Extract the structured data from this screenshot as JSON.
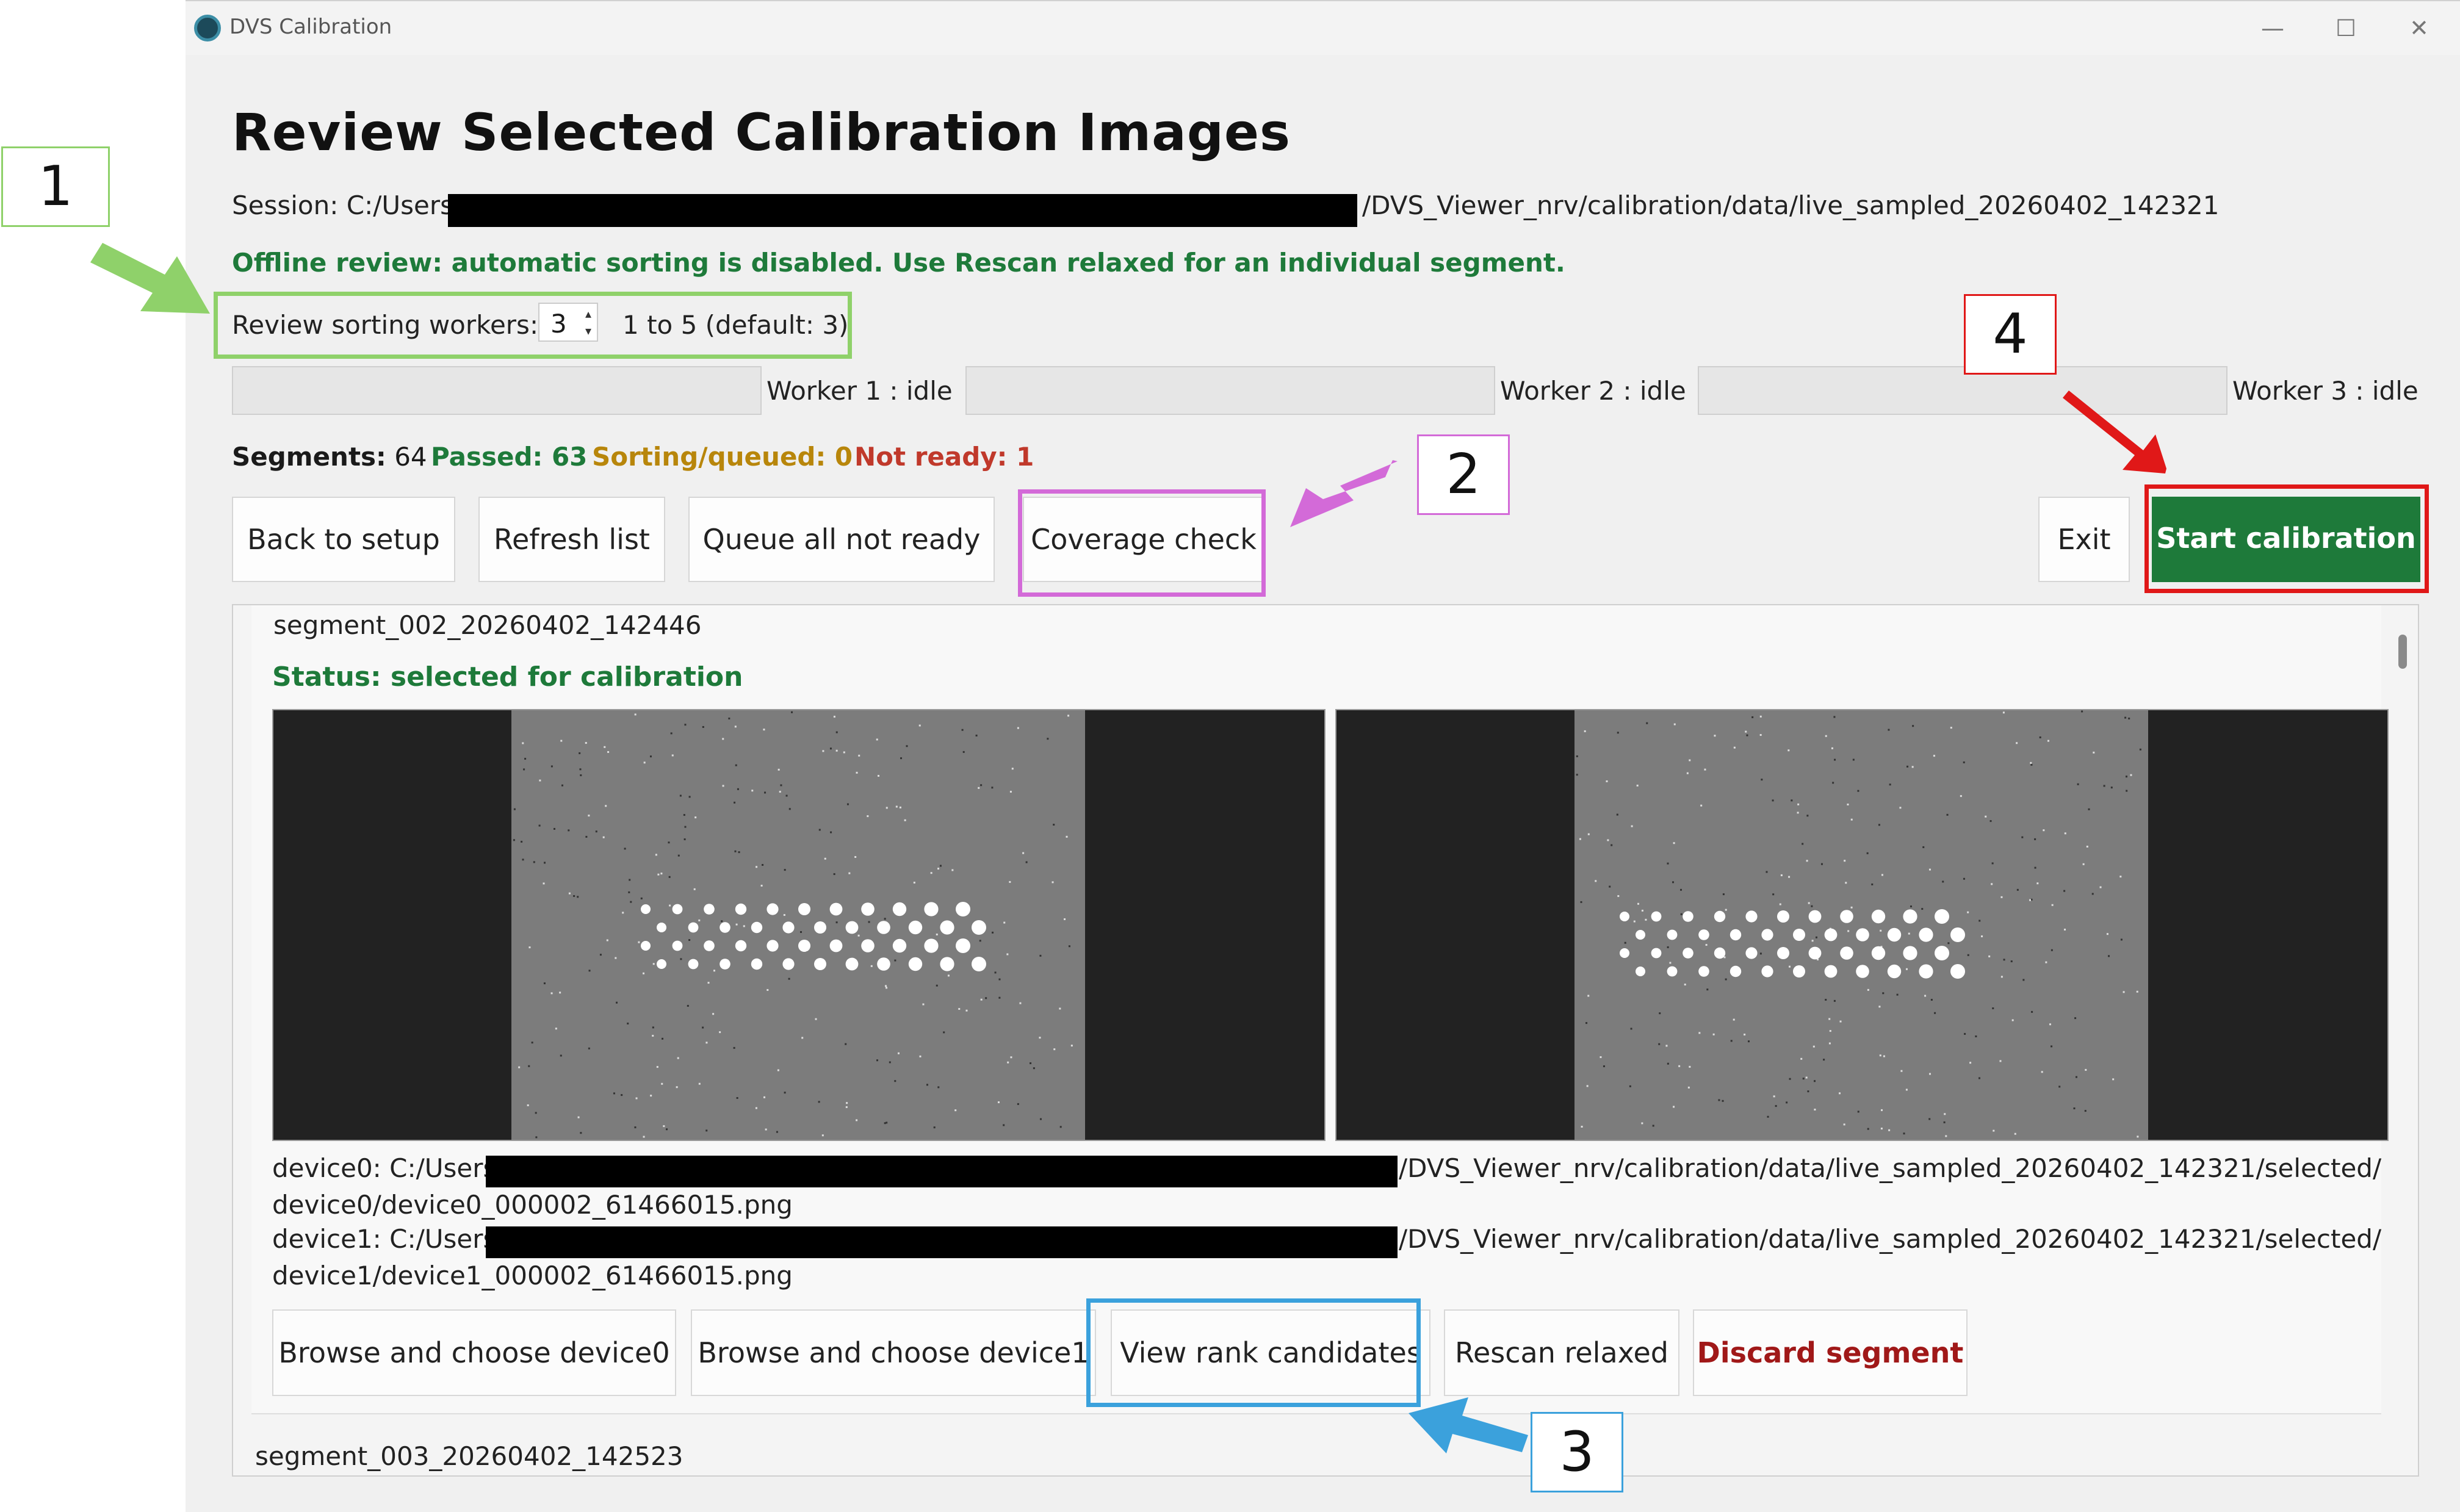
{
  "window": {
    "title": "DVS Calibration",
    "controls": {
      "minimize": "—",
      "maximize": "☐",
      "close": "✕"
    }
  },
  "header": {
    "title": "Review Selected Calibration Images",
    "session_label": "Session: C:/Users/",
    "session_suffix": "/DVS_Viewer_nrv/calibration/data/live_sampled_20260402_142321",
    "offline_message": "Offline review: automatic sorting is disabled. Use Rescan relaxed for an individual segment."
  },
  "workers": {
    "label": "Review sorting workers:",
    "value": "3",
    "range_text": "1 to 5 (default: 3)",
    "items": [
      {
        "label": "Worker 1 : idle",
        "progress": 0
      },
      {
        "label": "Worker 2 : idle",
        "progress": 0
      },
      {
        "label": "Worker 3 : idle",
        "progress": 0
      }
    ]
  },
  "stats": {
    "segments_label": "Segments:",
    "segments_value": "64",
    "passed": "Passed: 63",
    "sorting": "Sorting/queued: 0",
    "not_ready": "Not ready: 1",
    "colors": {
      "passed": "#1e7a3a",
      "sorting": "#b8860b",
      "not_ready": "#c0392b"
    }
  },
  "toolbar": {
    "back": "Back to setup",
    "refresh": "Refresh list",
    "queue": "Queue all not ready",
    "coverage": "Coverage check",
    "exit": "Exit",
    "start": "Start calibration",
    "start_color": "#1e7a3a"
  },
  "segment": {
    "name": "segment_002_20260402_142446",
    "status": "Status: selected for calibration",
    "device0_prefix": "device0: C:/Users/",
    "device0_suffix": "/DVS_Viewer_nrv/calibration/data/live_sampled_20260402_142321/selected/",
    "device0_file": "device0/device0_000002_61466015.png",
    "device1_prefix": "device1: C:/Users/",
    "device1_suffix": "/DVS_Viewer_nrv/calibration/data/live_sampled_20260402_142321/selected/",
    "device1_file": "device1/device1_000002_61466015.png",
    "buttons": {
      "browse0": "Browse and choose device0",
      "browse1": "Browse and choose device1",
      "rank": "View rank candidates",
      "rescan": "Rescan relaxed",
      "discard": "Discard segment"
    }
  },
  "next_segment": {
    "name": "segment_003_20260402_142523"
  },
  "annotations": [
    {
      "number": "1",
      "color": "#8fd16a"
    },
    {
      "number": "2",
      "color": "#d36ad8"
    },
    {
      "number": "3",
      "color": "#3ba1dc"
    },
    {
      "number": "4",
      "color": "#e01818"
    }
  ]
}
